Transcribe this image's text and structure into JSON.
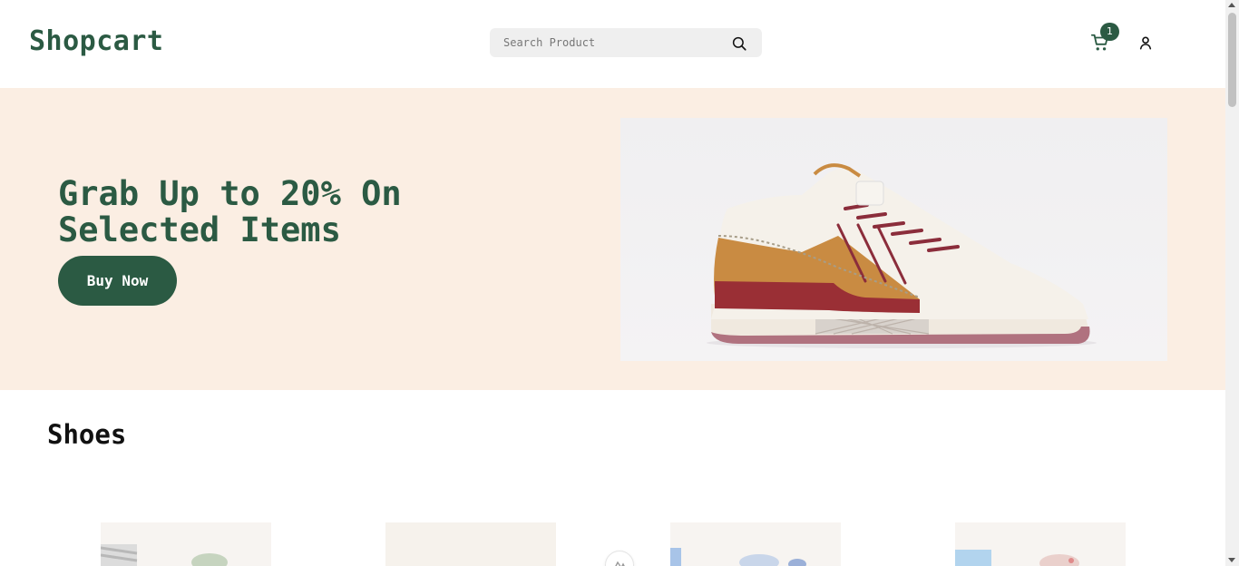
{
  "header": {
    "logo": "Shopcart",
    "search_placeholder": "Search Product",
    "cart_count": "1"
  },
  "hero": {
    "title": "Grab Up to 20% On Selected Items",
    "button_label": "Buy Now"
  },
  "section": {
    "title": "Shoes"
  },
  "colors": {
    "brand": "#2b5a43",
    "hero_bg": "#fbeee3"
  },
  "icons": [
    "search-icon",
    "cart-icon",
    "user-icon",
    "shoe-image",
    "spinner-icon"
  ]
}
